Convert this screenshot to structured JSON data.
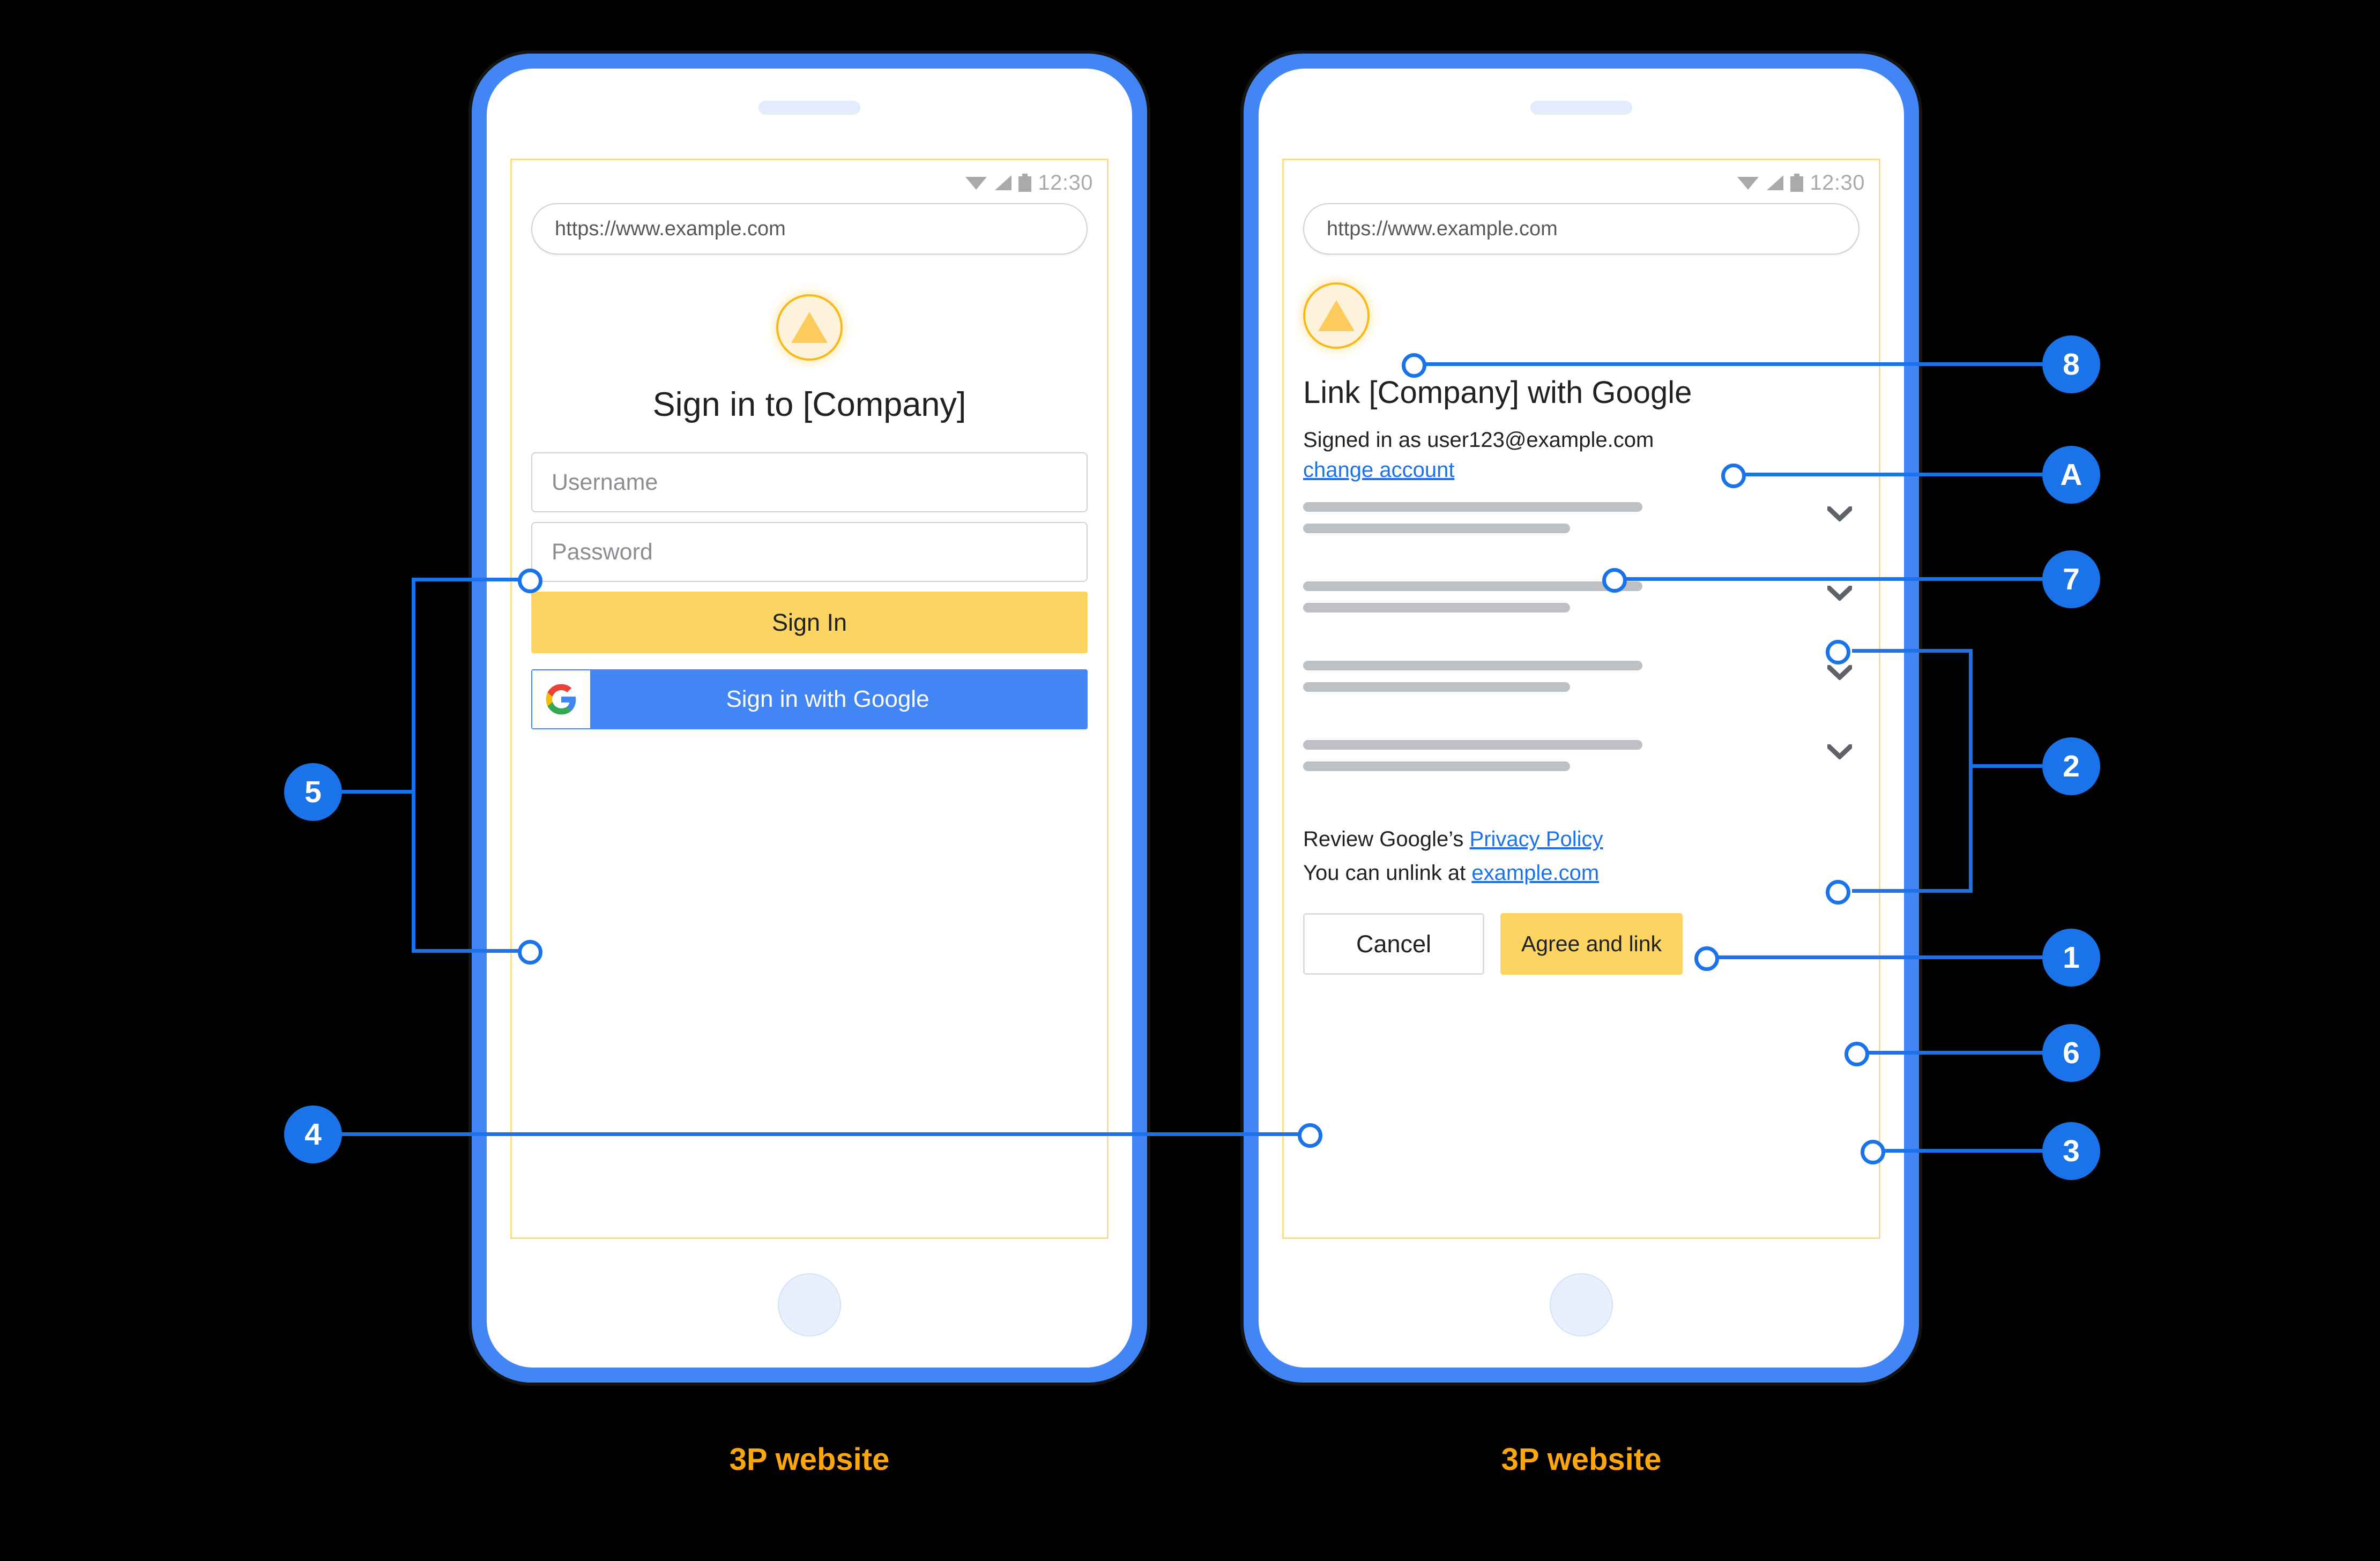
{
  "statusbar": {
    "time": "12:30"
  },
  "browser": {
    "url": "https://www.example.com"
  },
  "left_phone": {
    "caption": "3P website",
    "title": "Sign in to [Company]",
    "username_placeholder": "Username",
    "password_placeholder": "Password",
    "signin_label": "Sign In",
    "google_signin_label": "Sign in with Google"
  },
  "right_phone": {
    "caption": "3P website",
    "title": "Link [Company] with Google",
    "signed_in_as": "Signed in as user123@example.com",
    "change_account_label": "change account",
    "legal_prefix_1": "Review Google’s ",
    "privacy_policy_label": "Privacy Policy",
    "legal_prefix_2": "You can unlink at ",
    "unlink_site_label": "example.com",
    "cancel_label": "Cancel",
    "agree_label": "Agree and link",
    "scope_rows": [
      {
        "long": 61,
        "short": 48
      },
      {
        "long": 61,
        "short": 48
      },
      {
        "long": 61,
        "short": 48
      },
      {
        "long": 61,
        "short": 48
      }
    ]
  },
  "callouts": [
    {
      "id": "5",
      "label": "5"
    },
    {
      "id": "4",
      "label": "4"
    },
    {
      "id": "8",
      "label": "8"
    },
    {
      "id": "A",
      "label": "A"
    },
    {
      "id": "7",
      "label": "7"
    },
    {
      "id": "2",
      "label": "2"
    },
    {
      "id": "1",
      "label": "1"
    },
    {
      "id": "6",
      "label": "6"
    },
    {
      "id": "3",
      "label": "3"
    }
  ],
  "colors": {
    "brand_blue": "#1A73E8",
    "phone_blue": "#4285F4",
    "amber": "#FCD462",
    "caption_orange": "#FBA60B",
    "frame_yellow": "#FBDB8C",
    "placeholder_gray": "#BDC1C6"
  }
}
